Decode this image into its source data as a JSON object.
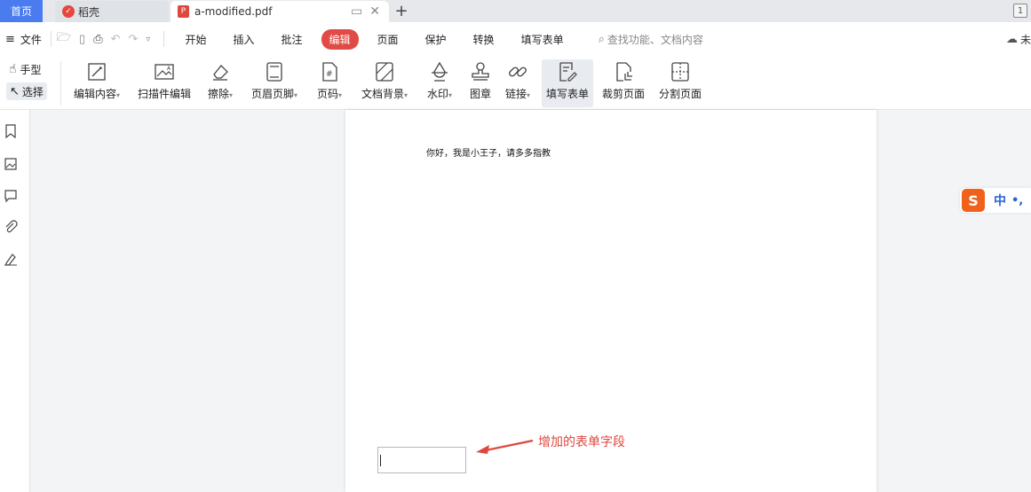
{
  "tabs": {
    "home": "首页",
    "daoke": "稻壳",
    "pdf": "a-modified.pdf",
    "page_indicator": "1"
  },
  "menu": {
    "file": "文件",
    "tabs": [
      "开始",
      "插入",
      "批注",
      "编辑",
      "页面",
      "保护",
      "转换",
      "填写表单"
    ],
    "active_tab": "编辑",
    "search_placeholder": "查找功能、文档内容",
    "cloud_status": "未"
  },
  "ribbon": {
    "hand": "手型",
    "select": "选择",
    "tools": [
      {
        "label": "编辑内容",
        "icon": "edit-content-icon",
        "dropdown": true
      },
      {
        "label": "扫描件编辑",
        "icon": "scan-edit-icon",
        "dropdown": false
      },
      {
        "label": "擦除",
        "icon": "eraser-icon",
        "dropdown": true
      },
      {
        "label": "页眉页脚",
        "icon": "header-footer-icon",
        "dropdown": true
      },
      {
        "label": "页码",
        "icon": "page-number-icon",
        "dropdown": true
      },
      {
        "label": "文档背景",
        "icon": "background-icon",
        "dropdown": true
      },
      {
        "label": "水印",
        "icon": "watermark-icon",
        "dropdown": true
      },
      {
        "label": "图章",
        "icon": "stamp-icon",
        "dropdown": false
      },
      {
        "label": "链接",
        "icon": "link-icon",
        "dropdown": true
      },
      {
        "label": "填写表单",
        "icon": "fill-form-icon",
        "dropdown": false
      },
      {
        "label": "裁剪页面",
        "icon": "crop-page-icon",
        "dropdown": false
      },
      {
        "label": "分割页面",
        "icon": "split-page-icon",
        "dropdown": false
      }
    ]
  },
  "document": {
    "text": "你好，我是小王子，请多多指教",
    "annotation": "增加的表单字段"
  },
  "ime": {
    "logo": "S",
    "mode": "中",
    "punct": "•,"
  },
  "colors": {
    "accent_tab": "#4a7cf0",
    "active_menu": "#e14b45",
    "annotation": "#e0463c"
  }
}
